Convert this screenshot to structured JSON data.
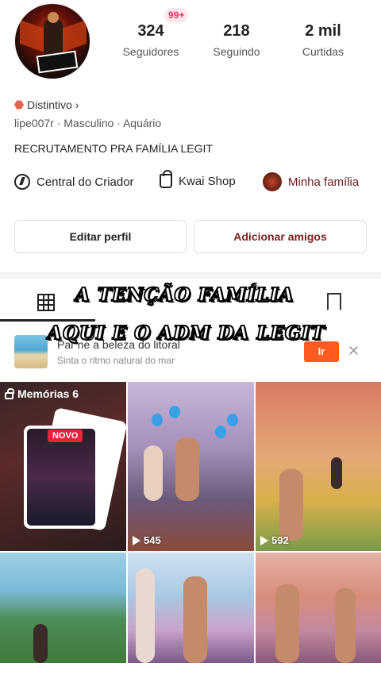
{
  "profile": {
    "notification_badge": "99+",
    "stats": [
      {
        "value": "324",
        "label": "Seguidores"
      },
      {
        "value": "218",
        "label": "Seguindo"
      },
      {
        "value": "2 mil",
        "label": "Curtidas"
      }
    ],
    "distintivo": "Distintivo",
    "meta": "lipe007r · Masculino · Aquário",
    "bio": "RECRUTAMENTO PRA FAMÍLIA LEGIT"
  },
  "links": {
    "creator": "Central do Criador",
    "shop": "Kwai Shop",
    "family": "Minha família"
  },
  "buttons": {
    "edit": "Editar perfil",
    "add": "Adicionar amigos"
  },
  "overlay": {
    "line1": "A TENÇÃO  FAMÍLIA",
    "line2": "AQUI E O ADM  DA LEGIT"
  },
  "ad": {
    "title": "Par  ne a beleza do litoral",
    "subtitle": "Sinta o ritmo natural do mar",
    "cta": "Ir",
    "close": "✕"
  },
  "grid": {
    "memories_label": "Memórias 6",
    "novo": "NOVO",
    "views": [
      "545",
      "592"
    ]
  }
}
